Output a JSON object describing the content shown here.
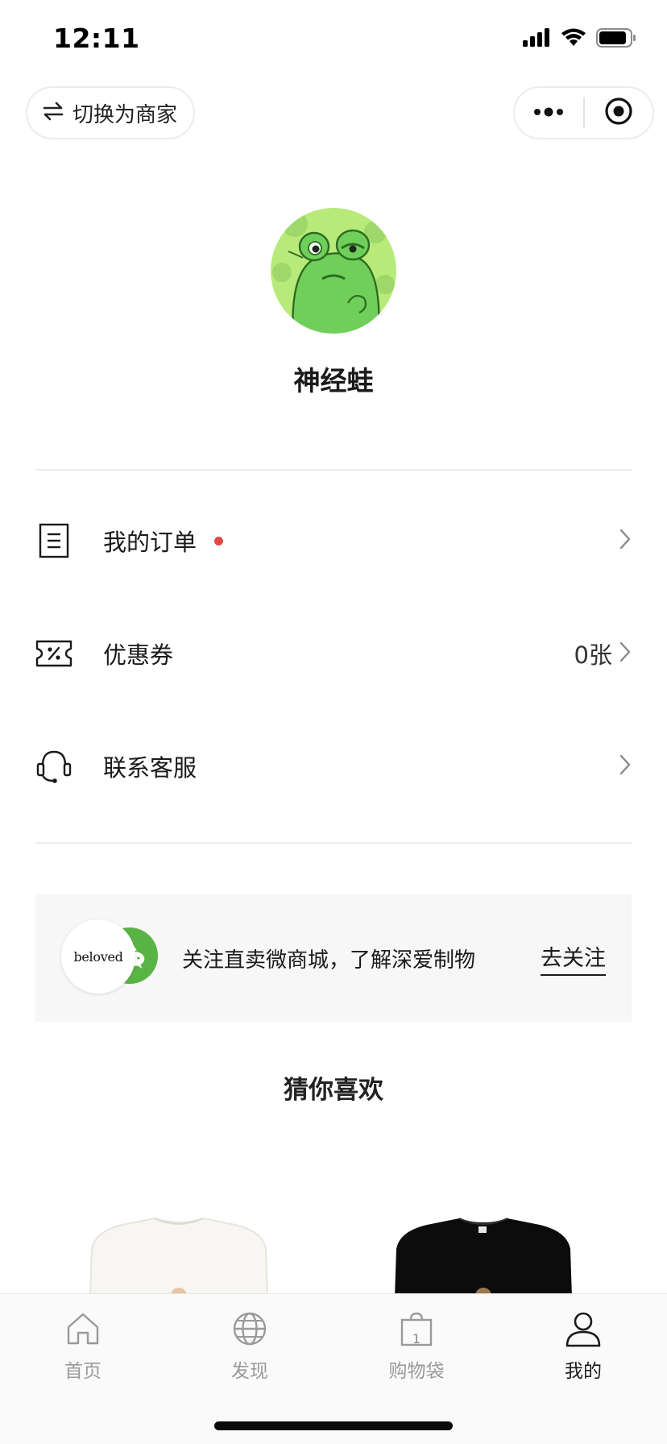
{
  "status_bar": {
    "time": "12:11",
    "icons": [
      "signal-icon",
      "wifi-icon",
      "battery-icon"
    ]
  },
  "header": {
    "switch_label": "切换为商家",
    "switch_icon": "swap-arrows-icon",
    "capsule_icons": [
      "more-icon",
      "close-target-icon"
    ]
  },
  "profile": {
    "username": "神经蛙",
    "avatar_icon": "frog-avatar"
  },
  "menu": {
    "items": [
      {
        "label": "我的订单",
        "icon": "order-list-icon",
        "value": "",
        "has_dot": true
      },
      {
        "label": "优惠券",
        "icon": "coupon-icon",
        "value": "0张",
        "has_dot": false
      },
      {
        "label": "联系客服",
        "icon": "headset-icon",
        "value": "",
        "has_dot": false
      }
    ]
  },
  "follow_banner": {
    "logo_text": "beloved",
    "text": "关注直卖微商城，了解深爱制物",
    "button": "去关注"
  },
  "recommend": {
    "title": "猜你喜欢"
  },
  "tab_bar": {
    "tabs": [
      {
        "label": "首页",
        "icon": "home-icon",
        "active": false
      },
      {
        "label": "发现",
        "icon": "globe-icon",
        "active": false
      },
      {
        "label": "购物袋",
        "icon": "shopping-bag-icon",
        "active": false,
        "badge": "1"
      },
      {
        "label": "我的",
        "icon": "person-icon",
        "active": true
      }
    ]
  },
  "colors": {
    "accent_dot": "#e34848",
    "wechat_green": "#5ab445",
    "frog_green": "#6fcf5a",
    "banner_bg": "#f7f7f7"
  }
}
